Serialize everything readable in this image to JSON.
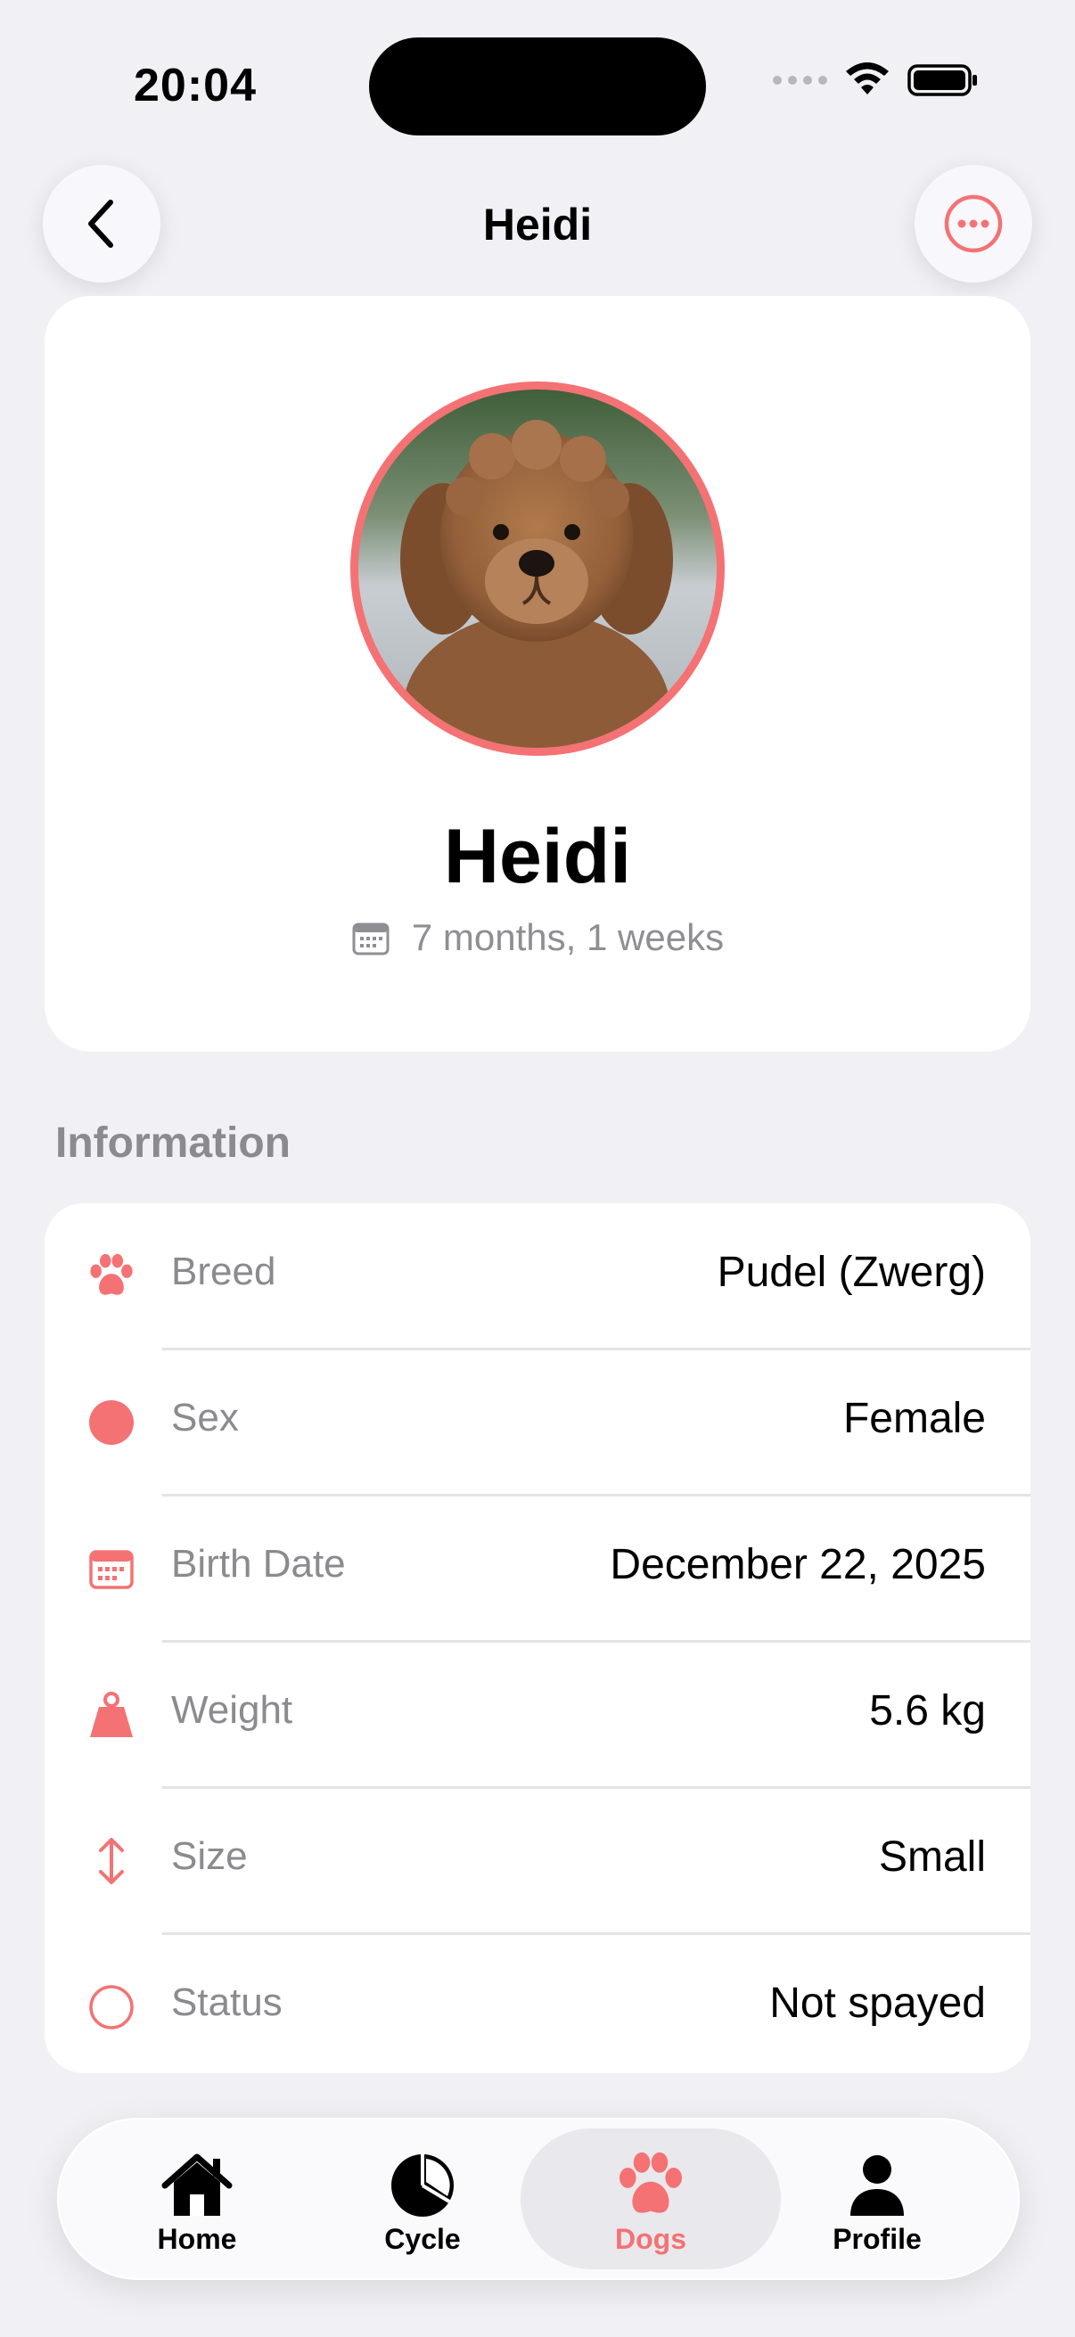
{
  "status_bar": {
    "time": "20:04"
  },
  "nav": {
    "title": "Heidi",
    "back_icon": "chevron-left-icon",
    "more_icon": "ellipsis-circle-icon"
  },
  "profile": {
    "name": "Heidi",
    "age": "7 months, 1 weeks",
    "age_icon": "calendar-icon",
    "photo": "dog-photo"
  },
  "information": {
    "section_title": "Information",
    "rows": [
      {
        "icon": "paw-icon",
        "label": "Breed",
        "value": "Pudel (Zwerg)"
      },
      {
        "icon": "filled-circle-icon",
        "label": "Sex",
        "value": "Female"
      },
      {
        "icon": "calendar-icon",
        "label": "Birth Date",
        "value": "December 22, 2025"
      },
      {
        "icon": "scale-weight-icon",
        "label": "Weight",
        "value": "5.6 kg"
      },
      {
        "icon": "vertical-arrows-icon",
        "label": "Size",
        "value": "Small"
      },
      {
        "icon": "empty-circle-icon",
        "label": "Status",
        "value": "Not spayed"
      }
    ]
  },
  "tab_bar": {
    "active": "Dogs",
    "tabs": [
      {
        "label": "Home",
        "icon": "house-icon"
      },
      {
        "label": "Cycle",
        "icon": "pie-chart-icon"
      },
      {
        "label": "Dogs",
        "icon": "paw-icon"
      },
      {
        "label": "Profile",
        "icon": "person-icon"
      }
    ]
  },
  "colors": {
    "accent": "#f47274",
    "background": "#f1f0f5",
    "secondary_text": "#8a8a8f"
  }
}
